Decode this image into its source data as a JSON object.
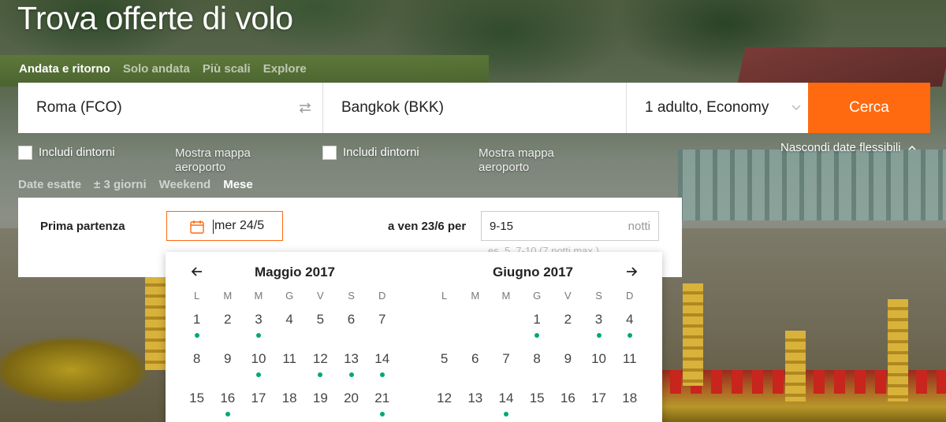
{
  "page": {
    "title": "Trova offerte di volo"
  },
  "trip_tabs": [
    {
      "label": "Andata e ritorno",
      "active": true
    },
    {
      "label": "Solo andata",
      "active": false
    },
    {
      "label": "Più scali",
      "active": false
    },
    {
      "label": "Explore",
      "active": false
    }
  ],
  "search": {
    "origin": "Roma (FCO)",
    "destination": "Bangkok (BKK)",
    "passengers": "1 adulto, Economy",
    "submit_label": "Cerca",
    "accent_color": "#ff690f"
  },
  "options": {
    "origin_nearby_label": "Includi dintorni",
    "origin_map_label": "Mostra mappa aeroporto",
    "dest_nearby_label": "Includi dintorni",
    "dest_map_label": "Mostra mappa aeroporto",
    "hide_flexible_label": "Nascondi date flessibili"
  },
  "date_tabs": [
    {
      "label": "Date esatte",
      "active": false
    },
    {
      "label": "± 3 giorni",
      "active": false
    },
    {
      "label": "Weekend",
      "active": false
    },
    {
      "label": "Mese",
      "active": true
    }
  ],
  "flex_panel": {
    "first_departure_label": "Prima partenza",
    "first_departure_value": "mer 24/5",
    "last_label": "a ven 23/6 per",
    "nights_value": "9-15",
    "nights_unit": "notti",
    "nights_hint": "es. 5, 7-10 (7 notti max.)"
  },
  "calendar": {
    "weekday_headers": [
      "L",
      "M",
      "M",
      "G",
      "V",
      "S",
      "D"
    ],
    "dot_color": "#00a878",
    "months": [
      {
        "title": "Maggio 2017",
        "weeks": [
          [
            {
              "d": "1",
              "dot": true
            },
            {
              "d": "2",
              "dot": false
            },
            {
              "d": "3",
              "dot": true
            },
            {
              "d": "4",
              "dot": false
            },
            {
              "d": "5",
              "dot": false
            },
            {
              "d": "6",
              "dot": false
            },
            {
              "d": "7",
              "dot": false
            }
          ],
          [
            {
              "d": "8",
              "dot": false
            },
            {
              "d": "9",
              "dot": false
            },
            {
              "d": "10",
              "dot": true
            },
            {
              "d": "11",
              "dot": false
            },
            {
              "d": "12",
              "dot": true
            },
            {
              "d": "13",
              "dot": true
            },
            {
              "d": "14",
              "dot": true
            }
          ],
          [
            {
              "d": "15",
              "dot": false
            },
            {
              "d": "16",
              "dot": true
            },
            {
              "d": "17",
              "dot": false
            },
            {
              "d": "18",
              "dot": false
            },
            {
              "d": "19",
              "dot": false
            },
            {
              "d": "20",
              "dot": false
            },
            {
              "d": "21",
              "dot": true
            }
          ]
        ]
      },
      {
        "title": "Giugno 2017",
        "weeks": [
          [
            {
              "d": "",
              "dot": false
            },
            {
              "d": "",
              "dot": false
            },
            {
              "d": "",
              "dot": false
            },
            {
              "d": "1",
              "dot": true
            },
            {
              "d": "2",
              "dot": false
            },
            {
              "d": "3",
              "dot": true
            },
            {
              "d": "4",
              "dot": true
            }
          ],
          [
            {
              "d": "5",
              "dot": false
            },
            {
              "d": "6",
              "dot": false
            },
            {
              "d": "7",
              "dot": false
            },
            {
              "d": "8",
              "dot": false
            },
            {
              "d": "9",
              "dot": false
            },
            {
              "d": "10",
              "dot": false
            },
            {
              "d": "11",
              "dot": false
            }
          ],
          [
            {
              "d": "12",
              "dot": false
            },
            {
              "d": "13",
              "dot": false
            },
            {
              "d": "14",
              "dot": true
            },
            {
              "d": "15",
              "dot": false
            },
            {
              "d": "16",
              "dot": false
            },
            {
              "d": "17",
              "dot": false
            },
            {
              "d": "18",
              "dot": false
            }
          ]
        ]
      }
    ]
  }
}
